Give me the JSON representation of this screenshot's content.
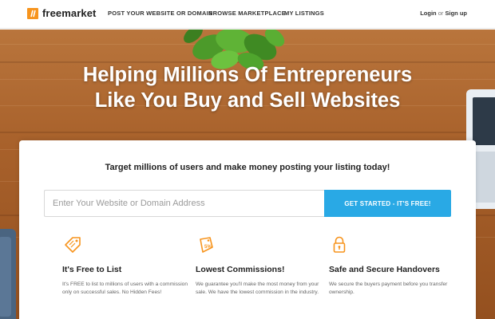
{
  "brand": {
    "logo_mark": "//",
    "name": "freemarket",
    "accent": "#f7941d"
  },
  "nav": {
    "links": [
      {
        "label": "POST YOUR WEBSITE OR DOMAIN"
      },
      {
        "label": "BROWSE MARKETPLACE"
      },
      {
        "label": "MY LISTINGS"
      }
    ],
    "login_label": "Login",
    "or_label": "or",
    "signup_label": "Sign up"
  },
  "hero": {
    "title_line1": "Helping Millions Of Entrepreneurs",
    "title_line2": "Like You Buy and Sell Websites"
  },
  "card": {
    "tagline": "Target millions of users and make money posting your listing today!",
    "search": {
      "placeholder": "Enter Your Website or Domain Address",
      "value": ""
    },
    "cta_label": "GET STARTED - IT'S FREE!",
    "cta_color": "#29a9e5",
    "features": [
      {
        "icon": "price-tag-icon",
        "title": "It's Free to List",
        "description": "It's FREE to list to millions of users with a commission only on successful sales. No Hidden Fees!"
      },
      {
        "icon": "percent-tag-icon",
        "icon_text": "5%",
        "title": "Lowest Commissions!",
        "description": "We guarantee you'll make the most money from your sale. We have the lowest commission in the industry."
      },
      {
        "icon": "padlock-icon",
        "title": "Safe and Secure Handovers",
        "description": "We secure the buyers payment before you transfer ownership."
      }
    ]
  }
}
